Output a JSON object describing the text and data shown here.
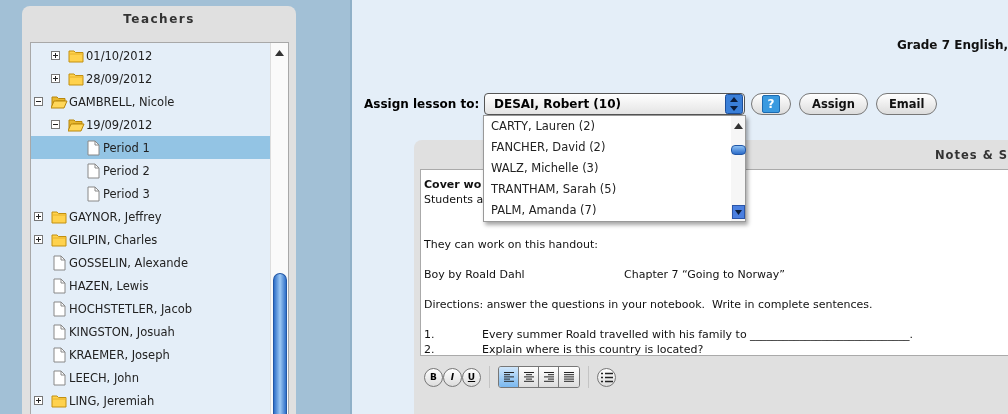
{
  "sidebar": {
    "title": "Teachers",
    "tree": [
      {
        "kind": "continued",
        "children": [
          {
            "kind": "folder",
            "label": "01/10/2012",
            "expanded": false,
            "selected": false
          },
          {
            "kind": "folder",
            "label": "28/09/2012",
            "expanded": false,
            "selected": false
          }
        ]
      },
      {
        "kind": "folder",
        "label": "GAMBRELL, Nicole",
        "expanded": true,
        "selected": false,
        "children": [
          {
            "kind": "folder",
            "label": "19/09/2012",
            "expanded": true,
            "selected": false,
            "children": [
              {
                "kind": "file",
                "label": "Period 1",
                "selected": true
              },
              {
                "kind": "file",
                "label": "Period 2",
                "selected": false
              },
              {
                "kind": "file",
                "label": "Period 3",
                "selected": false
              }
            ]
          }
        ]
      },
      {
        "kind": "folder",
        "label": "GAYNOR, Jeffrey",
        "expanded": false,
        "selected": false
      },
      {
        "kind": "folder",
        "label": "GILPIN, Charles",
        "expanded": false,
        "selected": false
      },
      {
        "kind": "file",
        "label": "GOSSELIN, Alexande",
        "selected": false
      },
      {
        "kind": "file",
        "label": "HAZEN, Lewis",
        "selected": false
      },
      {
        "kind": "file",
        "label": "HOCHSTETLER, Jacob",
        "selected": false
      },
      {
        "kind": "file",
        "label": "KINGSTON, Josuah",
        "selected": false
      },
      {
        "kind": "file",
        "label": "KRAEMER, Joseph",
        "selected": false
      },
      {
        "kind": "file",
        "label": "LEECH, John",
        "selected": false
      },
      {
        "kind": "folder",
        "label": "LING, Jeremiah",
        "expanded": false,
        "selected": false
      }
    ]
  },
  "lesson": {
    "title": "Grade 7 English,",
    "assign": {
      "label": "Assign lesson to:",
      "value": "DESAI, Robert (10)",
      "help": "?",
      "buttons": [
        "Assign",
        "Email"
      ],
      "options": [
        {
          "label": "CARTY, Lauren (2)",
          "selected": false
        },
        {
          "label": "FANCHER, David (2)",
          "selected": false
        },
        {
          "label": "WALZ, Michelle (3)",
          "selected": false
        },
        {
          "label": "TRANTHAM, Sarah (5)",
          "selected": false
        },
        {
          "label": "PALM, Amanda (7)",
          "selected": false
        }
      ]
    },
    "notes": {
      "title": "Notes & S",
      "lines": [
        {
          "kind": "text",
          "text": "Cover wo",
          "bold": true
        },
        {
          "kind": "text",
          "text": "Students a",
          "bold": false
        },
        {
          "kind": "blank"
        },
        {
          "kind": "blank"
        },
        {
          "kind": "text",
          "text": "They can work on this handout:",
          "bold": false
        },
        {
          "kind": "blank"
        },
        {
          "kind": "columns",
          "columns": [
            "Boy by Roald Dahl",
            "Chapter 7 “Going to Norway”"
          ]
        },
        {
          "kind": "blank"
        },
        {
          "kind": "text",
          "text": "Directions: answer the questions in your notebook.  Write in complete sentences.",
          "bold": false
        },
        {
          "kind": "blank"
        },
        {
          "kind": "numbered",
          "number": "1.",
          "text": "Every summer Roald travelled with his family to _____________________________."
        },
        {
          "kind": "numbered",
          "number": "2.",
          "text": "Explain where is this country is located?"
        }
      ],
      "toolbar": {
        "format": [
          {
            "label": "B",
            "kind": "bold"
          },
          {
            "label": "I",
            "kind": "italic"
          },
          {
            "label": "U",
            "kind": "underline"
          }
        ],
        "align": [
          {
            "kind": "left",
            "selected": true
          },
          {
            "kind": "center",
            "selected": false
          },
          {
            "kind": "right",
            "selected": false
          },
          {
            "kind": "justify",
            "selected": false
          }
        ],
        "list": {
          "kind": "bullets"
        }
      }
    }
  }
}
